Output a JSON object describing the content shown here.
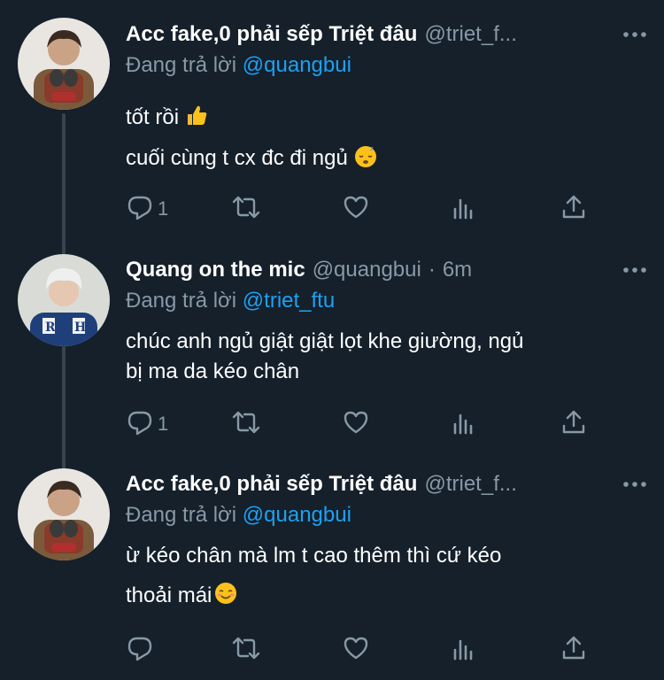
{
  "tweets": [
    {
      "display_name": "Acc fake,0 phải sếp Triệt đâu",
      "handle": "@triet_f...",
      "time_sep": "",
      "time": "",
      "replying_prefix": "Đang trả lời ",
      "replying_to": "@quangbui",
      "lines": [
        "tốt rồi",
        "cuối cùng t cx đc đi ngủ"
      ],
      "reply_count": "1"
    },
    {
      "display_name": "Quang on the mic",
      "handle": "@quangbui",
      "time_sep": "·",
      "time": "6m",
      "replying_prefix": "Đang trả lời ",
      "replying_to": "@triet_ftu",
      "lines": [
        "chúc anh ngủ giật giật lọt khe giường, ngủ",
        "bị ma da kéo chân"
      ],
      "reply_count": "1"
    },
    {
      "display_name": "Acc fake,0 phải sếp Triệt đâu",
      "handle": "@triet_f...",
      "time_sep": "",
      "time": "",
      "replying_prefix": "Đang trả lời ",
      "replying_to": "@quangbui",
      "lines": [
        "ừ kéo chân mà lm t cao thêm thì cứ kéo",
        "thoải mái"
      ],
      "reply_count": ""
    }
  ],
  "icons": {
    "reply": "reply-icon",
    "retweet": "retweet-icon",
    "like": "like-icon",
    "stats": "stats-icon",
    "share": "share-icon",
    "more": "more-icon",
    "thumbs_up": "thumbs-up-emoji",
    "sleepy": "sleeping-face-emoji",
    "smiling": "smiling-face-emoji"
  },
  "colors": {
    "background": "#15202b",
    "text": "#ffffff",
    "secondary": "#8899a6",
    "link": "#1da1f2",
    "thread_line": "#38444d"
  }
}
